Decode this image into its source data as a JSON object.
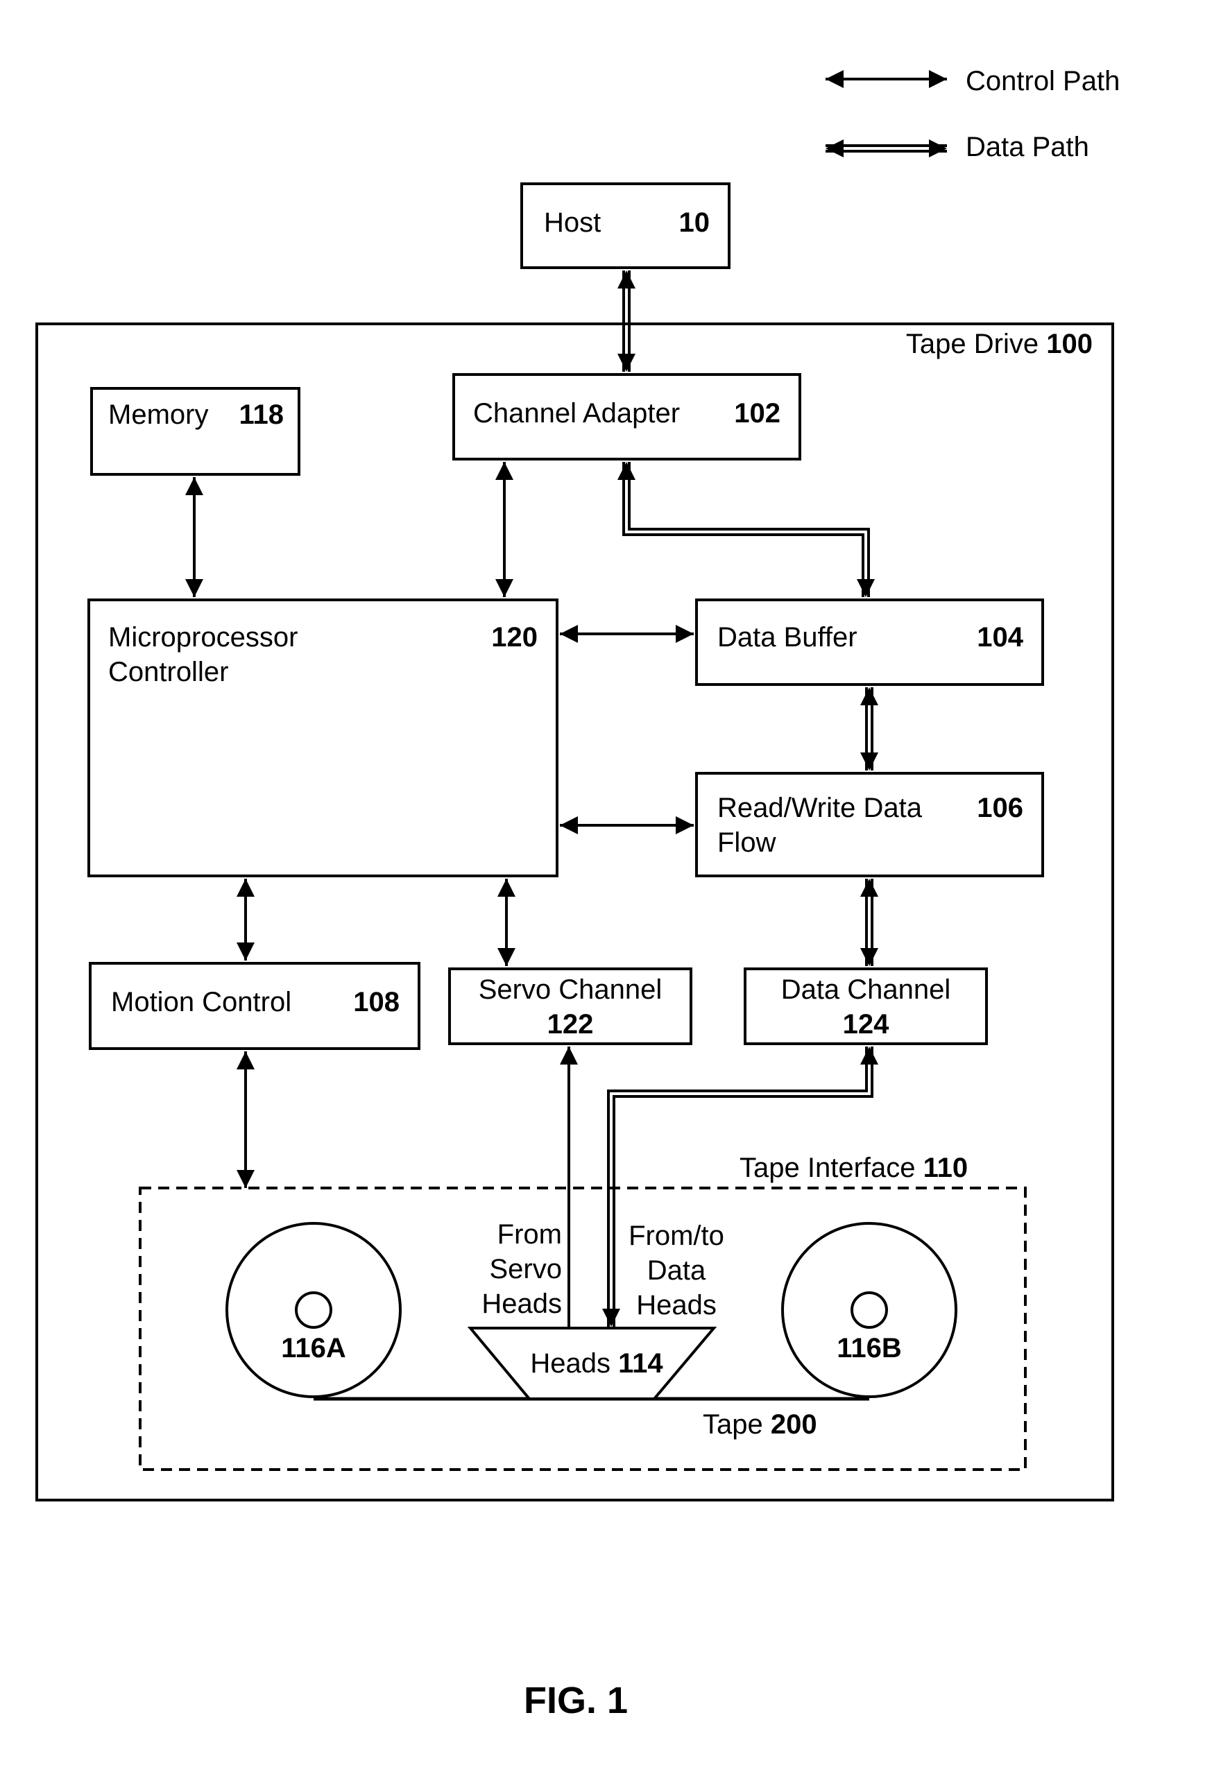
{
  "legend": {
    "control_path": "Control Path",
    "data_path": "Data Path"
  },
  "host": {
    "name": "Host",
    "ref": "10"
  },
  "tape_drive": {
    "name": "Tape Drive",
    "ref": "100"
  },
  "blocks": {
    "memory": {
      "name": "Memory",
      "ref": "118"
    },
    "channel_adapter": {
      "name": "Channel Adapter",
      "ref": "102"
    },
    "microprocessor": {
      "line1": "Microprocessor",
      "line2": "Controller",
      "ref": "120"
    },
    "data_buffer": {
      "name": "Data Buffer",
      "ref": "104"
    },
    "rw_data_flow": {
      "line1": "Read/Write Data",
      "line2": "Flow",
      "ref": "106"
    },
    "motion_control": {
      "name": "Motion Control",
      "ref": "108"
    },
    "servo_channel": {
      "name": "Servo Channel",
      "ref": "122"
    },
    "data_channel": {
      "name": "Data Channel",
      "ref": "124"
    }
  },
  "tape_interface": {
    "name": "Tape Interface",
    "ref": "110",
    "from_servo": [
      "From",
      "Servo",
      "Heads"
    ],
    "from_to_data": [
      "From/to",
      "Data",
      "Heads"
    ],
    "heads": {
      "name": "Heads",
      "ref": "114"
    },
    "reel_a": "116A",
    "reel_b": "116B",
    "tape": {
      "name": "Tape",
      "ref": "200"
    }
  },
  "figure_label": "FIG. 1"
}
